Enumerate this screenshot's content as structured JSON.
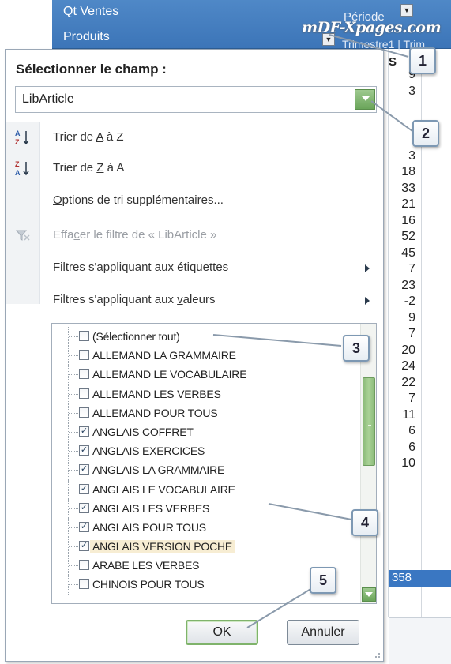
{
  "sheet": {
    "header_row1": "Qt Ventes",
    "header_row2": "Produits",
    "header_right_top": "Période",
    "header_right_bottom": "Trimestre1 | Trim",
    "watermark": "mDF-Xpages.com",
    "col_header": "S",
    "values": [
      "9",
      "3",
      "",
      "",
      "",
      "3",
      "18",
      "33",
      "21",
      "16",
      "52",
      "45",
      "7",
      "23",
      "-2",
      "9",
      "7",
      "20",
      "24",
      "22",
      "7",
      "11",
      "6",
      "6",
      "10"
    ],
    "total": "358"
  },
  "panel": {
    "title": "Sélectionner le champ :",
    "field_value": "LibArticle",
    "sort_az_prefix": "Trier de ",
    "sort_az_key": "A",
    "sort_az_suffix": " à Z",
    "sort_za_prefix": "Trier de ",
    "sort_za_key": "Z",
    "sort_za_suffix": " à A",
    "more_sort_key": "O",
    "more_sort_rest": "ptions de tri supplémentaires...",
    "clear_filter_a": "Effa",
    "clear_filter_key": "c",
    "clear_filter_b": "er le filtre de « LibArticle »",
    "label_filters_a": "Filtres s'app",
    "label_filters_key": "l",
    "label_filters_b": "iquant aux étiquettes",
    "value_filters_a": "Filtres s'appliquant aux ",
    "value_filters_key": "v",
    "value_filters_b": "aleurs",
    "items": [
      {
        "label": "(Sélectionner tout)",
        "checked": false
      },
      {
        "label": "ALLEMAND LA GRAMMAIRE",
        "checked": false
      },
      {
        "label": "ALLEMAND LE VOCABULAIRE",
        "checked": false
      },
      {
        "label": "ALLEMAND LES VERBES",
        "checked": false
      },
      {
        "label": "ALLEMAND POUR TOUS",
        "checked": false
      },
      {
        "label": "ANGLAIS COFFRET",
        "checked": true
      },
      {
        "label": "ANGLAIS EXERCICES",
        "checked": true
      },
      {
        "label": "ANGLAIS LA GRAMMAIRE",
        "checked": true
      },
      {
        "label": "ANGLAIS LE VOCABULAIRE",
        "checked": true
      },
      {
        "label": "ANGLAIS LES VERBES",
        "checked": true
      },
      {
        "label": "ANGLAIS POUR TOUS",
        "checked": true
      },
      {
        "label": "ANGLAIS VERSION POCHE",
        "checked": true
      },
      {
        "label": "ARABE LES VERBES",
        "checked": false
      },
      {
        "label": "CHINOIS POUR TOUS",
        "checked": false
      }
    ],
    "ok_label": "OK",
    "cancel_label": "Annuler"
  },
  "callouts": [
    "1",
    "2",
    "3",
    "4",
    "5"
  ],
  "icons": {
    "sort_az": "sort-ascending-icon",
    "sort_za": "sort-descending-icon",
    "clear_filter": "clear-filter-icon",
    "submenu": "chevron-right-icon"
  },
  "colors": {
    "header_blue": "#4f88c7",
    "accent_green": "#7fb36b",
    "selection": "#f7edd3"
  }
}
